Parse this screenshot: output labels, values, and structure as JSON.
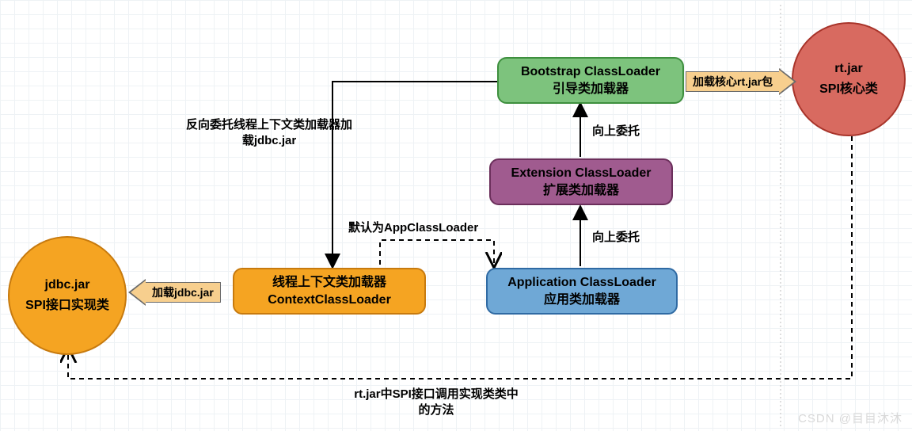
{
  "boxes": {
    "bootstrap": {
      "l1": "Bootstrap ClassLoader",
      "l2": "引导类加载器"
    },
    "extension": {
      "l1": "Extension ClassLoader",
      "l2": "扩展类加载器"
    },
    "application": {
      "l1": "Application ClassLoader",
      "l2": "应用类加载器"
    },
    "context": {
      "l1": "线程上下文类加载器",
      "l2": "ContextClassLoader"
    }
  },
  "circles": {
    "rtjar": {
      "l1": "rt.jar",
      "l2": "SPI核心类"
    },
    "jdbcjar": {
      "l1": "jdbc.jar",
      "l2": "SPI接口实现类"
    }
  },
  "arrows": {
    "loadRt": "加载核心rt.jar包",
    "loadJdbc": "加载jdbc.jar"
  },
  "labels": {
    "reverse": "反向委托线程上下文类加载器加载jdbc.jar",
    "delegate1": "向上委托",
    "delegate2": "向上委托",
    "defaultApp": "默认为AppClassLoader",
    "spiCall": "rt.jar中SPI接口调用实现类类中的方法"
  },
  "watermark": "CSDN @目目沐沐"
}
